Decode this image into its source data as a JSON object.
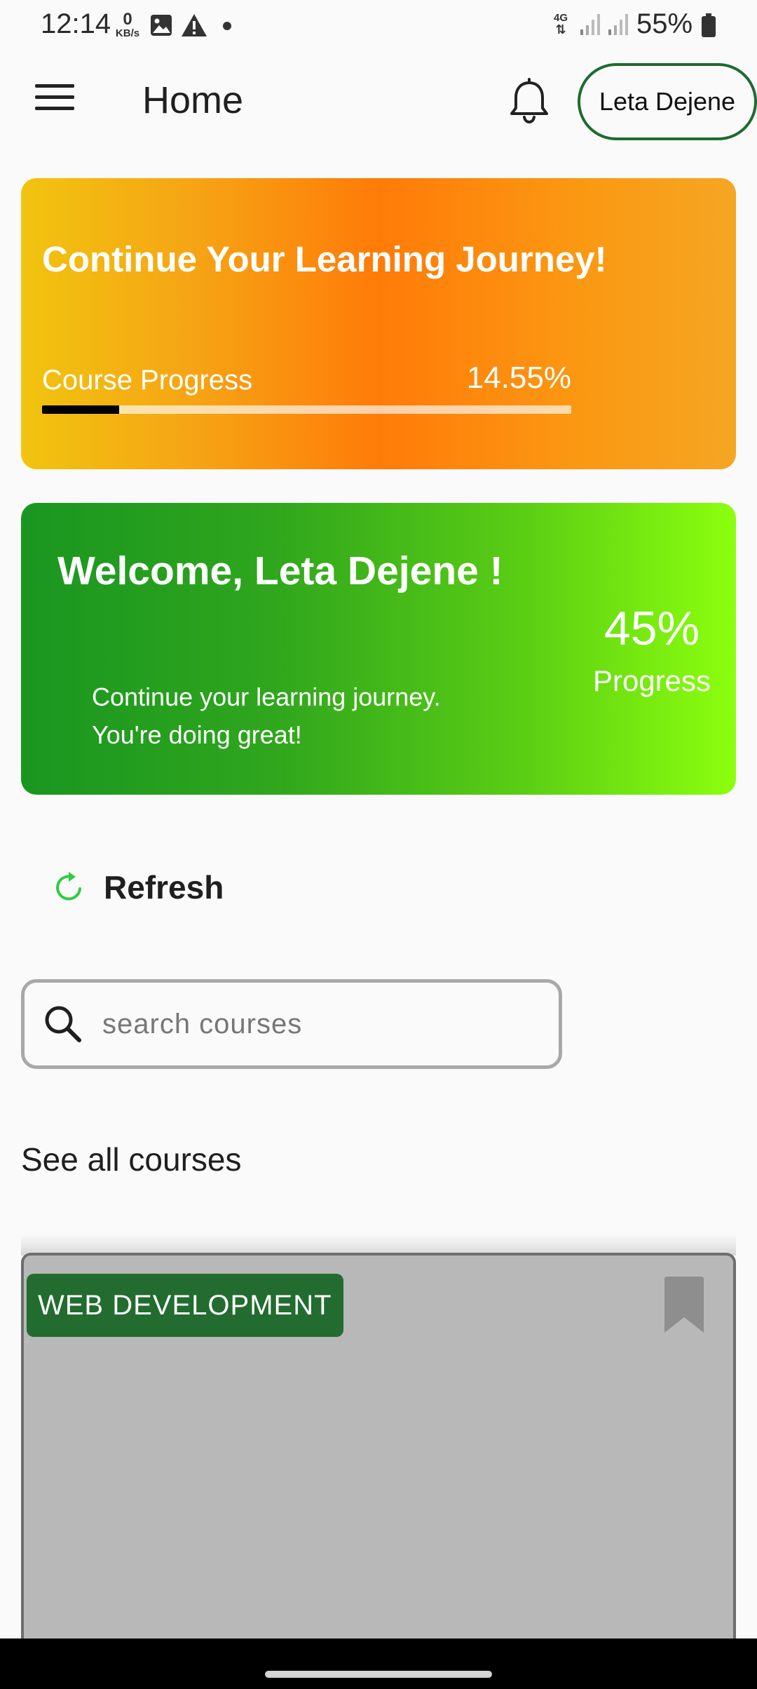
{
  "status_bar": {
    "time": "12:14",
    "data_rate_value": "0",
    "data_rate_unit": "KB/s",
    "network_type": "4G",
    "battery": "55%"
  },
  "app_bar": {
    "title": "Home",
    "user_name": "Leta Dejene"
  },
  "journey_card": {
    "title": "Continue Your Learning Journey!",
    "progress_label": "Course Progress",
    "progress_text": "14.55%",
    "progress_value": 14.55
  },
  "welcome_card": {
    "title": "Welcome, Leta Dejene !",
    "message_line1": "Continue your learning journey.",
    "message_line2": "You're doing great!",
    "progress_percent": "45%",
    "progress_label": "Progress"
  },
  "refresh": {
    "label": "Refresh"
  },
  "search": {
    "placeholder": "search courses",
    "value": ""
  },
  "courses": {
    "see_all_label": "See all courses",
    "items": [
      {
        "category": "WEB DEVELOPMENT"
      }
    ]
  },
  "colors": {
    "accent_green": "#1e6b2e",
    "badge_green": "#226c30",
    "refresh_green": "#2ecc40",
    "orange": "#ff7b08",
    "lime": "#8cff0e"
  },
  "icons": {
    "menu": "menu-icon",
    "notifications": "bell-icon",
    "refresh": "refresh-icon",
    "search": "search-icon",
    "bookmark": "bookmark-icon"
  }
}
